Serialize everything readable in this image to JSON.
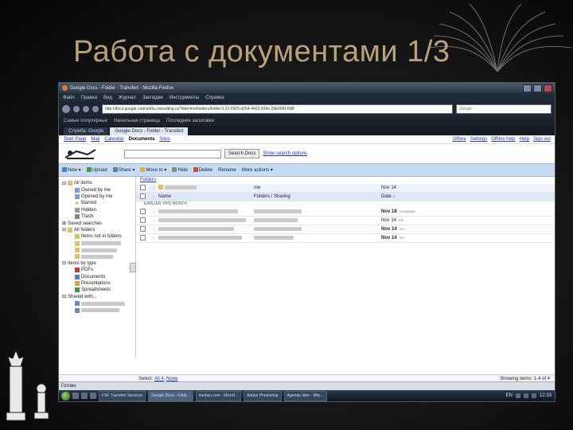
{
  "slide": {
    "title": "Работа с документами 1/3"
  },
  "browser": {
    "window_title": "Google Docs - Folder - Transfert - Mozilla Firefox",
    "menu": [
      "Файл",
      "Правка",
      "Вид",
      "Журнал",
      "Закладки",
      "Инструменты",
      "Справка"
    ],
    "url": "http://docs.google.com/a/kfu-consulting.ru/?tab=mo#folders/folder.0.23-2925-d254-4422-814c-29b0091458f",
    "search_placeholder": "Google",
    "bookmarks": [
      "Самые популярные",
      "Начальная страница",
      "Последние заголовки"
    ],
    "tabs": [
      "Служба: Google",
      "Google Docs - Folder - Transfert"
    ]
  },
  "gdocs": {
    "top_links": [
      "Start Page",
      "Mail",
      "Calendar",
      "Documents",
      "Sites"
    ],
    "active_top_link": "Documents",
    "right_links": [
      "Offline",
      "Settings",
      "Offline help",
      "Help",
      "Sign out"
    ],
    "search_button": "Search Docs",
    "search_options": "Show search options",
    "toolbar": [
      "New",
      "Upload",
      "Share",
      "Move to",
      "Hide",
      "Delete",
      "Rename",
      "More actions"
    ],
    "breadcrumb": "Folders",
    "sidebar": [
      {
        "label": "All items",
        "icon": "folder"
      },
      {
        "label": "Owned by me",
        "icon": "doc"
      },
      {
        "label": "Opened by me",
        "icon": "doc"
      },
      {
        "label": "Starred",
        "icon": "star"
      },
      {
        "label": "Hidden",
        "icon": "hidden"
      },
      {
        "label": "Trash",
        "icon": "trash"
      },
      {
        "label": "Saved searches",
        "icon": "search"
      },
      {
        "label": "All folders",
        "icon": "folder"
      },
      {
        "label": "Items not in folders",
        "icon": "folder"
      },
      {
        "label": "",
        "icon": "folder"
      },
      {
        "label": "",
        "icon": "folder"
      },
      {
        "label": "",
        "icon": "folder"
      },
      {
        "label": "Items by type",
        "icon": "type"
      },
      {
        "label": "PDFs",
        "icon": "pdf"
      },
      {
        "label": "Documents",
        "icon": "docs"
      },
      {
        "label": "Presentations",
        "icon": "pres"
      },
      {
        "label": "Spreadsheets",
        "icon": "sheet"
      },
      {
        "label": "Shared with...",
        "icon": "people"
      },
      {
        "label": "",
        "icon": "person"
      },
      {
        "label": "",
        "icon": "person"
      }
    ],
    "folder_row": {
      "owner": "me",
      "date": "Nov 14"
    },
    "columns": {
      "name": "Name",
      "sharing": "Folders / Sharing",
      "date": "Date ↓"
    },
    "section": "EARLIER THIS MONTH",
    "files": [
      {
        "date": "Nov 18",
        "sub": "Anastasia"
      },
      {
        "date": "Nov 14",
        "sub": "me"
      },
      {
        "date": "Nov 14",
        "sub": "me"
      },
      {
        "date": "Nov 14",
        "sub": "me"
      }
    ],
    "select_label": "Select:",
    "select_all": "All 4",
    "select_none": "None",
    "showing": "Showing items: 1-4 of 4"
  },
  "status_text": "Готово",
  "taskbar": {
    "buttons": [
      "FSF Transfert Services",
      "Google Docs - Foldr...",
      "mediso.com - Microf...",
      "Adobe Photoshop",
      "Agenda Idee - Micr..."
    ],
    "lang": "EN",
    "time": "12:33"
  },
  "colors": {
    "title": "#b9a27a",
    "toolbar": "#c9daf3",
    "link": "#2233cc"
  }
}
